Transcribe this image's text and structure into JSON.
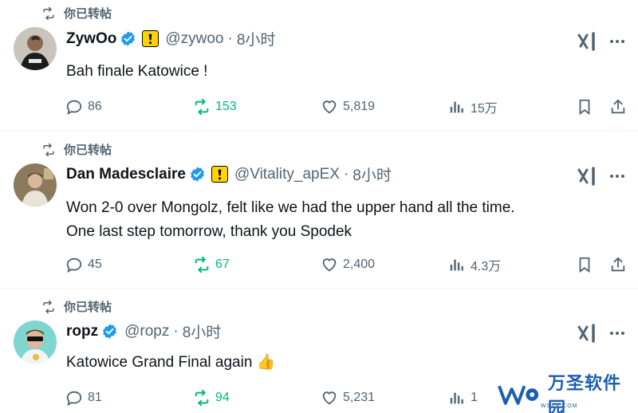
{
  "tweets": [
    {
      "repost_label": "你已转帖",
      "name": "ZywOo",
      "handle": "@zywoo",
      "time": "8小时",
      "lines": [
        "Bah finale Katowice !"
      ],
      "reply_count": "86",
      "repost_count": "153",
      "like_count": "5,819",
      "view_count": "15万"
    },
    {
      "repost_label": "你已转帖",
      "name": "Dan Madesclaire",
      "handle": "@Vitality_apEX",
      "time": "8小时",
      "lines": [
        "Won 2-0 over Mongolz, felt like we had the upper hand all the time.",
        "One last step tomorrow, thank you Spodek"
      ],
      "reply_count": "45",
      "repost_count": "67",
      "like_count": "2,400",
      "view_count": "4.3万"
    },
    {
      "repost_label": "你已转帖",
      "name": "ropz",
      "handle": "@ropz",
      "time": "8小时",
      "lines": [
        "Katowice Grand Final again 👍"
      ],
      "reply_count": "81",
      "repost_count": "94",
      "like_count": "5,231",
      "view_count": "1"
    }
  ],
  "separator": "·",
  "watermark": {
    "text": "万圣软件园",
    "sub": "WSZS.COM"
  },
  "colors": {
    "verified": "#1d9bf0",
    "repost_active": "#00ba7c",
    "secondary_text": "#536471",
    "affiliate_yellow": "#ffd400"
  },
  "icons": [
    "repost-icon",
    "verified-badge-icon",
    "vitality-affiliate-icon",
    "grok-icon",
    "more-icon",
    "reply-icon",
    "like-icon",
    "views-icon",
    "bookmark-icon",
    "share-icon"
  ]
}
